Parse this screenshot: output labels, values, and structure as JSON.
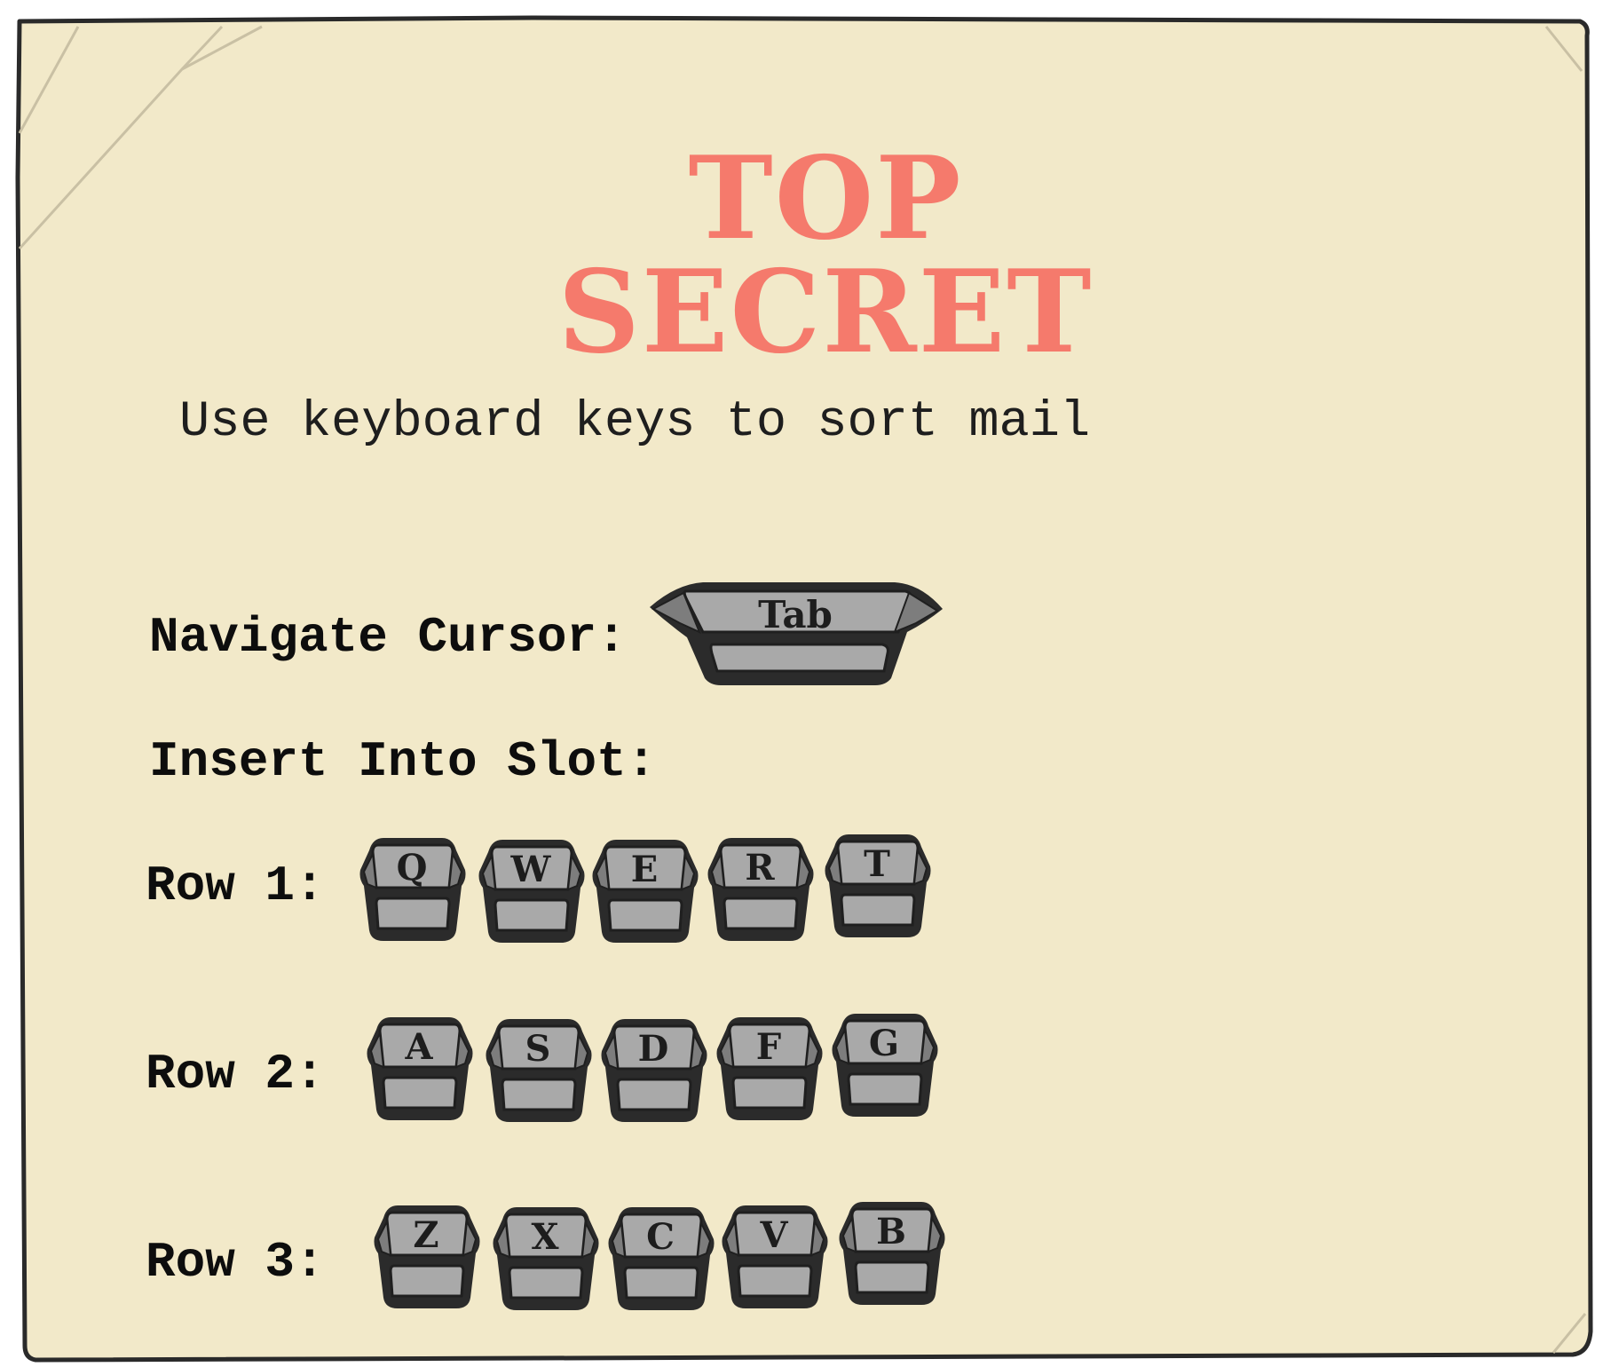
{
  "title": "TOP SECRET",
  "instruction": "Use keyboard keys to sort mail",
  "navigate": {
    "label": "Navigate Cursor:",
    "key": "Tab"
  },
  "insert_label": "Insert Into Slot:",
  "rows": [
    {
      "label": "Row 1:",
      "keys": [
        "Q",
        "W",
        "E",
        "R",
        "T"
      ]
    },
    {
      "label": "Row 2:",
      "keys": [
        "A",
        "S",
        "D",
        "F",
        "G"
      ]
    },
    {
      "label": "Row 3:",
      "keys": [
        "Z",
        "X",
        "C",
        "V",
        "B"
      ]
    }
  ],
  "colors": {
    "paper": "#f2e9c9",
    "title": "#f57a6c",
    "key_face": "#a9a9a9",
    "key_outline": "#2b2b2b"
  }
}
